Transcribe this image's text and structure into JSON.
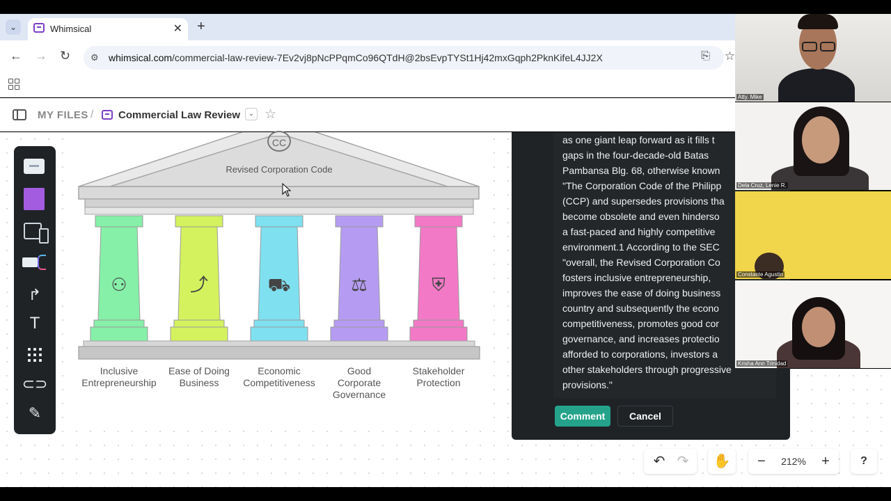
{
  "browser": {
    "tab_title": "Whimsical",
    "new_tab": "+",
    "tab_close": "✕",
    "url_host": "whimsical.com",
    "url_path": "/commercial-law-review-7Ev2vj8pNcPPqmCo96QTdH@2bsEvpTYSt1Hj42mxGqph2PknKifeL4JJ2X"
  },
  "header": {
    "my_files": "MY FILES",
    "separator": "/",
    "board_title": "Commercial Law Review"
  },
  "diagram": {
    "logo": "CC",
    "title": "Revised Corporation Code",
    "pillars": [
      {
        "label": "Inclusive\nEntrepreneurship",
        "color": "#86f0a8",
        "icon": "people-handshake-icon"
      },
      {
        "label": "Ease of Doing\nBusiness",
        "color": "#d4f25e",
        "icon": "route-arrows-icon"
      },
      {
        "label": "Economic\nCompetitiveness",
        "color": "#7fe0f0",
        "icon": "cars-icon"
      },
      {
        "label": "Good\nCorporate\nGovernance",
        "color": "#b59cf2",
        "icon": "scales-icon"
      },
      {
        "label": "Stakeholder\nProtection",
        "color": "#f279c6",
        "icon": "shield-people-icon"
      }
    ]
  },
  "comment": {
    "text": "as one giant leap forward as it fills t\ngaps in the four-decade-old Batas\nPambansa Blg. 68, otherwise known\n\"The Corporation Code of the Philipp\n(CCP) and supersedes provisions tha\nbecome obsolete and even hinderso\na fast-paced and highly competitive\nenvironment.1 According to the SEC\n\"overall, the Revised Corporation Co\nfosters inclusive entrepreneurship,\nimproves the ease of doing business\ncountry and subsequently the econo\ncompetitiveness, promotes good cor\ngovernance, and increases protectio\nafforded to corporations, investors a\nother stakeholders through progressive\nprovisions.\"",
    "comment_button": "Comment",
    "cancel_button": "Cancel"
  },
  "controls": {
    "zoom": "212%",
    "help": "?",
    "zoom_out": "−",
    "zoom_in": "+"
  },
  "participants": [
    {
      "name": "Atty. Mike",
      "bg": "#e8e6e2"
    },
    {
      "name": "Dela Cruz, Lenie R.",
      "bg": "#f4f3f1"
    },
    {
      "name": "Constante Agustin",
      "bg": "#f1d54a"
    },
    {
      "name": "Krisha Ann Trinidad",
      "bg": "#f6f5f4"
    }
  ]
}
